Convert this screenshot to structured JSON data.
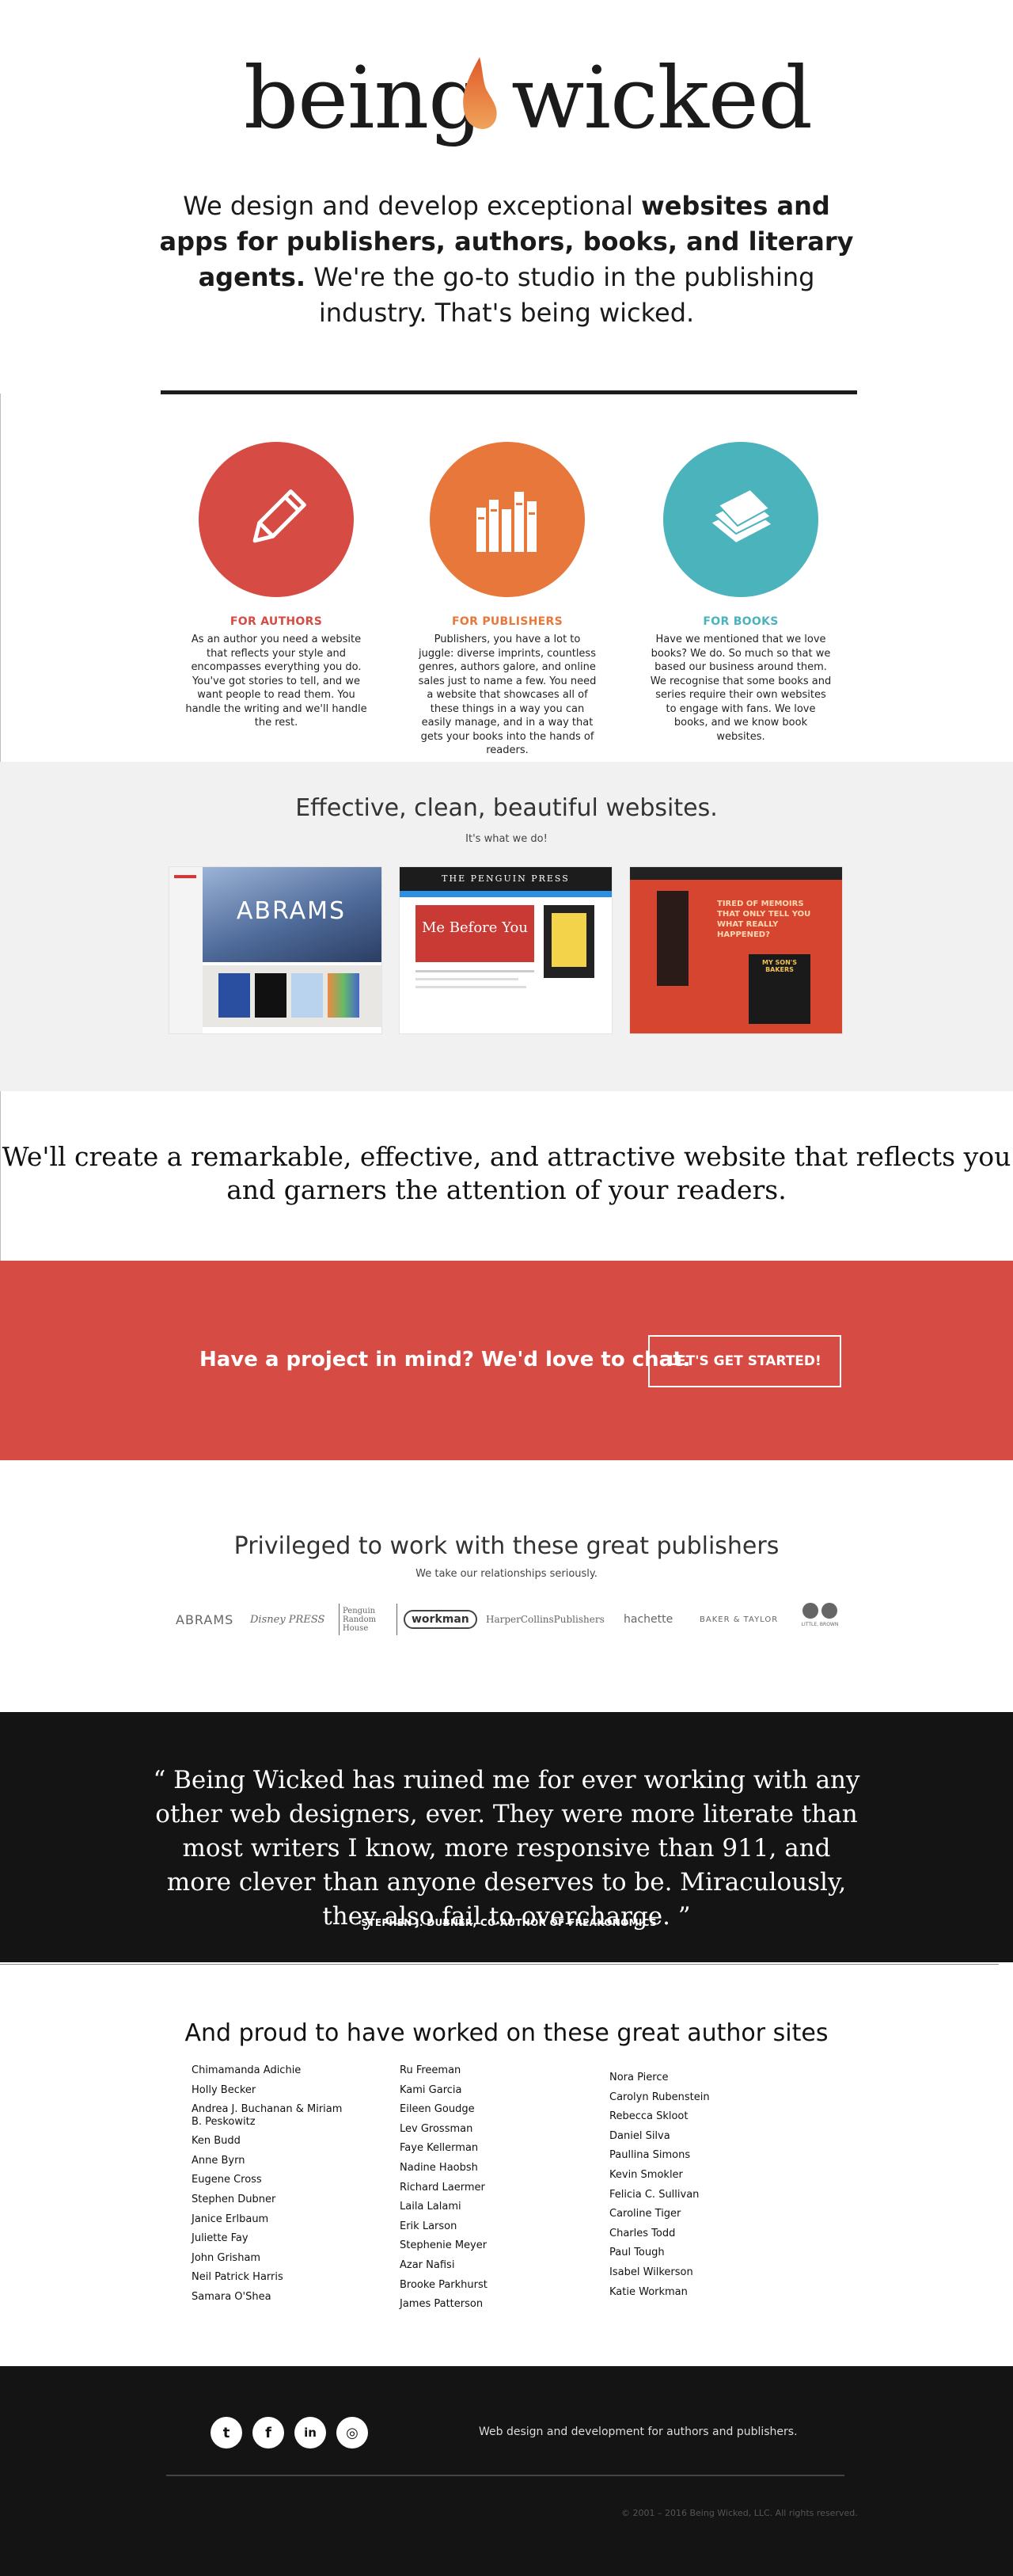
{
  "brand": {
    "part1": "being",
    "part2": "wicked",
    "flame_color": "#e06a3a"
  },
  "intro": {
    "line1_plain": "We design and develop exceptional ",
    "line1_bold": "websites and apps for publishers, authors, books, and literary agents.",
    "line2": " We're the go-to studio in the publishing industry. That's being wicked."
  },
  "services": [
    {
      "title": "FOR AUTHORS",
      "color": "#d64c45",
      "icon": "pencil-icon",
      "text": "As an author you need a website that reflects your style and encompasses everything you do. You've got stories to tell, and we want people to read them. You handle the writing and we'll handle the rest."
    },
    {
      "title": "FOR PUBLISHERS",
      "color": "#e8773b",
      "icon": "books-icon",
      "text": "Publishers, you have a lot to juggle: diverse imprints, countless genres, authors galore, and online sales just to name a few. You need a website that showcases all of these things in a way you can easily manage, and in a way that gets your books into the hands of readers."
    },
    {
      "title": "FOR BOOKS",
      "color": "#4ab3bc",
      "icon": "book-stack-icon",
      "text": "Have we mentioned that we love books? We do. So much so that we based our business around them. We recognise that some books and series require their own websites to engage with fans. We love books, and we know book websites."
    }
  ],
  "showcase": {
    "title": "Effective, clean, beautiful websites.",
    "subtitle": "It's what we do!",
    "sites": [
      {
        "label": "ABRAMS"
      },
      {
        "label": "THE PENGUIN PRESS",
        "book": "Me Before You"
      },
      {
        "label": "TIRED OF MEMOIRS THAT ONLY TELL YOU WHAT REALLY HAPPENED?",
        "book": "MY SON'S BAKERS"
      }
    ]
  },
  "tagline": "We'll create a remarkable, effective, and attractive website that reflects you and garners the attention of your readers.",
  "cta": {
    "text": "Have a project in mind? We'd love to chat.",
    "button": "LET'S GET STARTED!"
  },
  "publishers": {
    "title": "Privileged to work with these great publishers",
    "subtitle": "We take our relationships seriously.",
    "logos": [
      "ABRAMS",
      "Disney PRESS",
      "Penguin Random House",
      "workman",
      "HarperCollinsPublishers",
      "hachette",
      "BAKER & TAYLOR",
      "LITTLE, BROWN"
    ]
  },
  "quote": {
    "text": "“ Being Wicked has ruined me for ever working with any other web designers, ever. They were more literate than most writers I know, more responsive than 911, and more clever than anyone deserves to be. Miraculously, they also fail to overcharge. ”",
    "author": "–STEPHEN J. DUBNER, CO-AUTHOR OF FREAKONOMICS"
  },
  "authors": {
    "title": "And proud to have worked on these great author sites",
    "col1": [
      "Chimamanda Adichie",
      "Holly Becker",
      "Andrea J. Buchanan & Miriam B. Peskowitz",
      "Ken Budd",
      "Anne Byrn",
      "Eugene Cross",
      "Stephen Dubner",
      "Janice Erlbaum",
      "Juliette Fay",
      "John Grisham",
      "Neil Patrick Harris",
      "Samara O'Shea"
    ],
    "col2": [
      "Ru Freeman",
      "Kami Garcia",
      "Eileen Goudge",
      "Lev Grossman",
      "Faye Kellerman",
      "Nadine Haobsh",
      "Richard Laermer",
      "Laila Lalami",
      "Erik Larson",
      "Stephenie Meyer",
      "Azar Nafisi",
      "Brooke Parkhurst",
      "James Patterson"
    ],
    "col3": [
      "Nora Pierce",
      "Carolyn Rubenstein",
      "Rebecca Skloot",
      "Daniel Silva",
      "Paullina Simons",
      "Kevin Smokler",
      "Felicia C. Sullivan",
      "Caroline Tiger",
      "Charles Todd",
      "Paul Tough",
      "Isabel Wilkerson",
      "Katie Workman"
    ]
  },
  "footer": {
    "social": [
      "twitter-icon",
      "facebook-icon",
      "linkedin-icon",
      "instagram-icon"
    ],
    "social_glyphs": [
      "t",
      "f",
      "in",
      "◎"
    ],
    "text": "Web design and development for authors and publishers.",
    "copyright": "© 2001 – 2016 Being Wicked, LLC. All rights reserved."
  }
}
